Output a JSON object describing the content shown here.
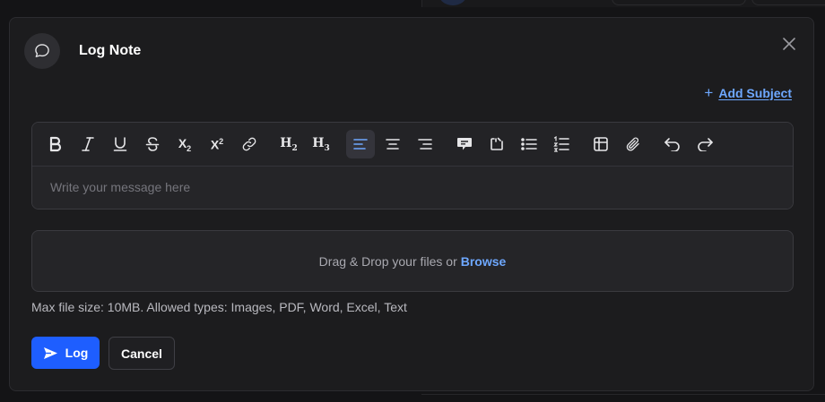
{
  "modal": {
    "title": "Log Note",
    "header_icon": "chat-bubble-icon",
    "close_icon": "close-icon"
  },
  "subject": {
    "add_label": "Add Subject",
    "plus": "+"
  },
  "toolbar": {
    "items": [
      {
        "name": "bold",
        "icon": "bold-icon"
      },
      {
        "name": "italic",
        "icon": "italic-icon"
      },
      {
        "name": "underline",
        "icon": "underline-icon"
      },
      {
        "name": "strikethrough",
        "icon": "strikethrough-icon"
      },
      {
        "name": "subscript",
        "icon": "subscript-icon"
      },
      {
        "name": "superscript",
        "icon": "superscript-icon"
      },
      {
        "name": "link",
        "icon": "link-icon"
      },
      {
        "name": "heading-2",
        "label": "H2"
      },
      {
        "name": "heading-3",
        "label": "H3"
      },
      {
        "name": "align-left",
        "icon": "align-left-icon",
        "active": true
      },
      {
        "name": "align-center",
        "icon": "align-center-icon"
      },
      {
        "name": "align-right",
        "icon": "align-right-icon"
      },
      {
        "name": "comment",
        "icon": "comment-icon"
      },
      {
        "name": "callout",
        "icon": "callout-icon"
      },
      {
        "name": "bullet-list",
        "icon": "bullet-list-icon"
      },
      {
        "name": "numbered-list",
        "icon": "numbered-list-icon"
      },
      {
        "name": "table",
        "icon": "table-icon"
      },
      {
        "name": "attachment",
        "icon": "paperclip-icon"
      },
      {
        "name": "undo",
        "icon": "undo-icon"
      },
      {
        "name": "redo",
        "icon": "redo-icon"
      }
    ],
    "h2_label": "H",
    "h2_sub": "2",
    "h3_label": "H",
    "h3_sub": "3",
    "subscript_label": "X",
    "subscript_sub": "2",
    "superscript_label": "X",
    "superscript_sup": "2"
  },
  "editor": {
    "placeholder": "Write your message here"
  },
  "dropzone": {
    "text": "Drag & Drop your files or",
    "browse": "Browse"
  },
  "hint": "Max file size: 10MB. Allowed types: Images, PDF, Word, Excel, Text",
  "actions": {
    "log_label": "Log",
    "cancel_label": "Cancel"
  },
  "colors": {
    "accent": "#1e5eff",
    "link": "#6ea8ff",
    "surface": "#1c1c1e"
  }
}
